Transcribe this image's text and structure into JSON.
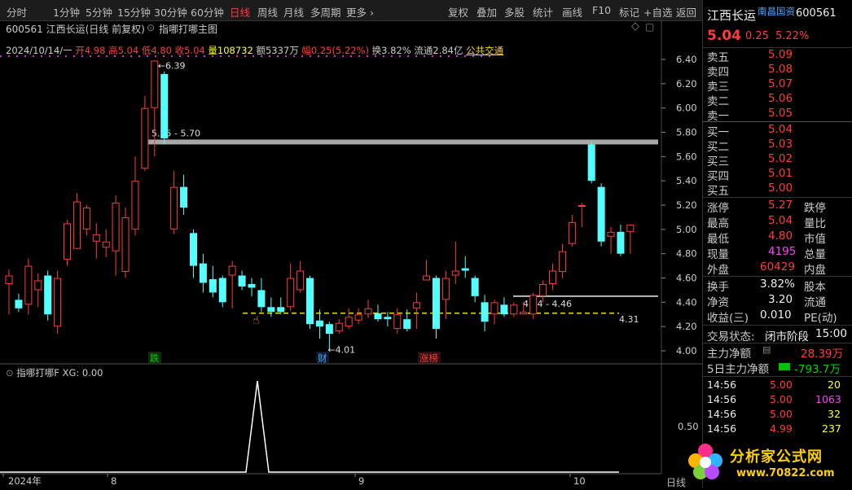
{
  "toolbar": {
    "periods": [
      "分时",
      "1分钟",
      "5分钟",
      "15分钟",
      "30分钟",
      "60分钟",
      "日线",
      "周线",
      "月线",
      "多周期",
      "更多"
    ],
    "active_period": "日线",
    "tools": [
      "复权",
      "叠加",
      "多股",
      "统计",
      "画线",
      "F10",
      "标记",
      "+自选",
      "返回"
    ]
  },
  "chart_header": {
    "title": "600561 江西长运(日线 前复权)",
    "formula_name": "指哪打哪主图"
  },
  "quote_line": {
    "date": "2024/10/14/一",
    "open_label": "开",
    "open": "4.98",
    "high_label": "高",
    "high": "5.04",
    "low_label": "低",
    "low": "4.80",
    "close_label": "收",
    "close": "5.04",
    "volume_label": "量",
    "volume": "108732",
    "amount_label": "额",
    "amount": "5337万",
    "change_label": "幅",
    "change": "0.25(5.22%)",
    "turnover_label": "换",
    "turnover": "3.82%",
    "float_label": "流通",
    "float": "2.84亿",
    "sector": "公共交通"
  },
  "chart_data": {
    "type": "candlestick",
    "y_ticks": [
      "6.40",
      "6.20",
      "6.00",
      "5.80",
      "5.60",
      "5.40",
      "5.20",
      "5.00",
      "4.80",
      "4.60",
      "4.40",
      "4.20",
      "4.00"
    ],
    "ylim": [
      3.94,
      6.5
    ],
    "candles": [
      [
        4.55,
        4.62,
        4.67,
        4.3
      ],
      [
        4.42,
        4.35,
        4.47,
        4.32
      ],
      [
        4.38,
        4.7,
        4.76,
        4.3
      ],
      [
        4.5,
        4.58,
        4.64,
        4.36
      ],
      [
        4.62,
        4.3,
        4.66,
        4.25
      ],
      [
        4.2,
        4.6,
        4.66,
        4.14
      ],
      [
        4.75,
        5.05,
        5.08,
        4.7
      ],
      [
        4.84,
        5.23,
        5.3,
        4.84
      ],
      [
        5.0,
        5.18,
        5.2,
        4.95
      ],
      [
        4.9,
        4.96,
        5.05,
        4.76
      ],
      [
        4.85,
        4.9,
        5.0,
        4.77
      ],
      [
        4.82,
        5.22,
        5.28,
        4.62
      ],
      [
        4.65,
        5.1,
        5.18,
        4.6
      ],
      [
        5.0,
        5.4,
        5.6,
        4.95
      ],
      [
        5.5,
        6.0,
        6.1,
        5.48
      ],
      [
        6.0,
        6.39,
        6.39,
        5.6
      ],
      [
        6.28,
        5.75,
        6.3,
        5.7
      ],
      [
        5.0,
        5.35,
        5.48,
        4.96
      ],
      [
        5.35,
        5.18,
        5.45,
        5.12
      ],
      [
        4.97,
        4.7,
        5.0,
        4.6
      ],
      [
        4.72,
        4.56,
        4.8,
        4.48
      ],
      [
        4.59,
        4.48,
        4.7,
        4.44
      ],
      [
        4.6,
        4.4,
        4.62,
        4.36
      ],
      [
        4.62,
        4.7,
        4.74,
        4.35
      ],
      [
        4.62,
        4.53,
        4.66,
        4.5
      ],
      [
        4.55,
        4.52,
        4.6,
        4.45
      ],
      [
        4.5,
        4.36,
        4.6,
        4.32
      ],
      [
        4.36,
        4.32,
        4.44,
        4.28
      ],
      [
        4.36,
        4.32,
        4.44,
        4.3
      ],
      [
        4.36,
        4.6,
        4.72,
        4.33
      ],
      [
        4.5,
        4.66,
        4.74,
        4.48
      ],
      [
        4.6,
        4.22,
        4.62,
        4.18
      ],
      [
        4.25,
        4.2,
        4.34,
        4.1
      ],
      [
        4.22,
        4.14,
        4.24,
        4.01
      ],
      [
        4.16,
        4.23,
        4.26,
        4.14
      ],
      [
        4.2,
        4.28,
        4.35,
        4.18
      ],
      [
        4.25,
        4.3,
        4.35,
        4.22
      ],
      [
        4.3,
        4.35,
        4.42,
        4.27
      ],
      [
        4.31,
        4.26,
        4.38,
        4.24
      ],
      [
        4.28,
        4.26,
        4.32,
        4.2
      ],
      [
        4.18,
        4.3,
        4.35,
        4.14
      ],
      [
        4.26,
        4.18,
        4.34,
        4.16
      ],
      [
        4.35,
        4.4,
        4.48,
        4.18
      ],
      [
        4.58,
        4.62,
        4.75,
        4.58
      ],
      [
        4.6,
        4.18,
        4.62,
        4.1
      ],
      [
        4.42,
        4.6,
        4.66,
        4.26
      ],
      [
        4.62,
        4.66,
        4.9,
        4.55
      ],
      [
        4.68,
        4.66,
        4.78,
        4.6
      ],
      [
        4.6,
        4.45,
        4.62,
        4.4
      ],
      [
        4.4,
        4.24,
        4.46,
        4.16
      ],
      [
        4.3,
        4.4,
        4.42,
        4.22
      ],
      [
        4.38,
        4.3,
        4.44,
        4.28
      ],
      [
        4.3,
        4.38,
        4.4,
        4.28
      ],
      [
        4.3,
        4.32,
        4.4,
        4.3
      ],
      [
        4.3,
        4.46,
        4.48,
        4.26
      ],
      [
        4.45,
        4.55,
        4.58,
        4.4
      ],
      [
        4.55,
        4.66,
        4.72,
        4.5
      ],
      [
        4.65,
        4.82,
        4.88,
        4.6
      ],
      [
        4.88,
        5.06,
        5.12,
        4.86
      ],
      [
        5.2,
        5.2,
        5.22,
        5.02
      ],
      [
        5.7,
        5.4,
        5.72,
        5.38
      ],
      [
        5.35,
        4.9,
        5.38,
        4.86
      ],
      [
        4.94,
        4.98,
        5.02,
        4.8
      ],
      [
        4.98,
        4.8,
        5.04,
        4.78
      ],
      [
        4.98,
        5.04,
        5.04,
        4.8
      ]
    ],
    "resistance_price_label": "5.75 - 5.70",
    "resistance_price": 5.72,
    "support_price_label": "4.44 - 4.46",
    "support_price": 4.45,
    "dashed_level": 4.31,
    "dashed_level_label": "4.31",
    "high_marker": "6.39",
    "low_marker": "4.01",
    "markers": [
      "跌",
      "财",
      "涨榜"
    ],
    "x_ticks": [
      "2024年",
      "8",
      "9",
      "10"
    ]
  },
  "sub_chart": {
    "title": "指哪打哪F",
    "value_label": "XG: 0.00",
    "y_tick": "0.50",
    "right_tab": "日线"
  },
  "panel": {
    "name": "江西长运",
    "tag": "南昌国资",
    "code": "600561",
    "price": "5.04",
    "change": "0.25",
    "change_pct": "5.22%",
    "asks": [
      {
        "label": "卖五",
        "price": "5.09",
        "vol": ""
      },
      {
        "label": "卖四",
        "price": "5.08",
        "vol": ""
      },
      {
        "label": "卖三",
        "price": "5.07",
        "vol": ""
      },
      {
        "label": "卖二",
        "price": "5.06",
        "vol": ""
      },
      {
        "label": "卖一",
        "price": "5.05",
        "vol": ""
      }
    ],
    "bids": [
      {
        "label": "买一",
        "price": "5.04",
        "vol": ""
      },
      {
        "label": "买二",
        "price": "5.03",
        "vol": ""
      },
      {
        "label": "买三",
        "price": "5.02",
        "vol": ""
      },
      {
        "label": "买四",
        "price": "5.01",
        "vol": ""
      },
      {
        "label": "买五",
        "price": "5.00",
        "vol": ""
      }
    ],
    "stats": [
      {
        "l1": "涨停",
        "v1": "5.27",
        "c1": "red",
        "l2": "跌停"
      },
      {
        "l1": "最高",
        "v1": "5.04",
        "c1": "red",
        "l2": "量比"
      },
      {
        "l1": "最低",
        "v1": "4.80",
        "c1": "red",
        "l2": "市值"
      },
      {
        "l1": "现量",
        "v1": "4195",
        "c1": "mag",
        "l2": "总量"
      },
      {
        "l1": "外盘",
        "v1": "60429",
        "c1": "red",
        "l2": "内盘"
      }
    ],
    "stats2": [
      {
        "l1": "换手",
        "v1": "3.82%",
        "l2": "股本"
      },
      {
        "l1": "净资",
        "v1": "3.20",
        "l2": "流通"
      },
      {
        "l1": "收益(三)",
        "v1": "0.010",
        "l2": "PE(动)"
      }
    ],
    "trade_status_label": "交易状态:",
    "trade_status": "闭市阶段",
    "trade_time": "15:00",
    "main_flow_label": "主力净额",
    "main_flow": "28.39万",
    "main_flow5_label": "5日主力净额",
    "main_flow5": "-793.7万",
    "ticks": [
      {
        "time": "14:56",
        "price": "5.00",
        "vol": "20",
        "vcolor": "yel"
      },
      {
        "time": "14:56",
        "price": "5.00",
        "vol": "1063",
        "vcolor": "mag"
      },
      {
        "time": "14:56",
        "price": "5.00",
        "vol": "32",
        "vcolor": "yel"
      },
      {
        "time": "14:56",
        "price": "4.99",
        "vol": "237",
        "vcolor": "yel"
      }
    ]
  },
  "watermark": {
    "name": "分析家公式网",
    "url": "www.70822.com"
  }
}
